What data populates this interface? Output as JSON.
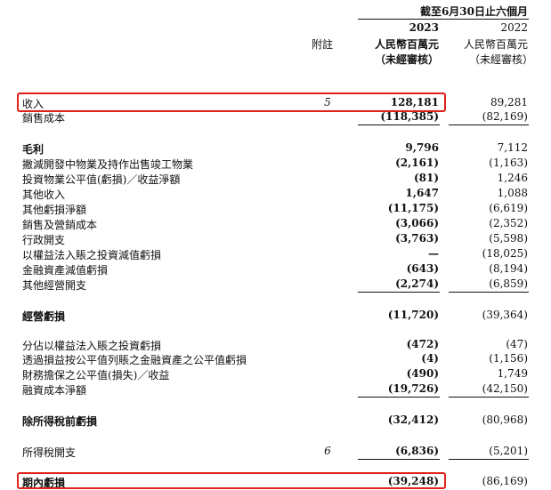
{
  "header": {
    "period": "截至6月30日止六個月",
    "note_label": "附註",
    "col2023": {
      "year": "2023",
      "unit": "人民幣百萬元",
      "audit": "（未經審核）"
    },
    "col2022": {
      "year": "2022",
      "unit": "人民幣百萬元",
      "audit": "（未經審核）"
    }
  },
  "rows": [
    {
      "label": "收入",
      "note": "5",
      "v2023": "128,181",
      "v2022": "89,281"
    },
    {
      "label": "銷售成本",
      "note": "",
      "v2023": "(118,385)",
      "v2022": "(82,169)"
    },
    {
      "label": "毛利",
      "note": "",
      "v2023": "9,796",
      "v2022": "7,112"
    },
    {
      "label": "撇減開發中物業及持作出售竣工物業",
      "note": "",
      "v2023": "(2,161)",
      "v2022": "(1,163)"
    },
    {
      "label": "投資物業公平值(虧損)／收益淨額",
      "note": "",
      "v2023": "(81)",
      "v2022": "1,246"
    },
    {
      "label": "其他收入",
      "note": "",
      "v2023": "1,647",
      "v2022": "1,088"
    },
    {
      "label": "其他虧損淨額",
      "note": "",
      "v2023": "(11,175)",
      "v2022": "(6,619)"
    },
    {
      "label": "銷售及營銷成本",
      "note": "",
      "v2023": "(3,066)",
      "v2022": "(2,352)"
    },
    {
      "label": "行政開支",
      "note": "",
      "v2023": "(3,763)",
      "v2022": "(5,598)"
    },
    {
      "label": "以權益法入賬之投資減值虧損",
      "note": "",
      "v2023": "—",
      "v2022": "(18,025)"
    },
    {
      "label": "金融資產減值虧損",
      "note": "",
      "v2023": "(643)",
      "v2022": "(8,194)"
    },
    {
      "label": "其他經營開支",
      "note": "",
      "v2023": "(2,274)",
      "v2022": "(6,859)"
    },
    {
      "label": "經營虧損",
      "note": "",
      "v2023": "(11,720)",
      "v2022": "(39,364)"
    },
    {
      "label": "分佔以權益法入賬之投資虧損",
      "note": "",
      "v2023": "(472)",
      "v2022": "(47)"
    },
    {
      "label": "透過損益按公平值列賬之金融資產之公平值虧損",
      "note": "",
      "v2023": "(4)",
      "v2022": "(1,156)"
    },
    {
      "label": "財務擔保之公平值(損失)／收益",
      "note": "",
      "v2023": "(490)",
      "v2022": "1,749"
    },
    {
      "label": "融資成本淨額",
      "note": "",
      "v2023": "(19,726)",
      "v2022": "(42,150)"
    },
    {
      "label": "除所得稅前虧損",
      "note": "",
      "v2023": "(32,412)",
      "v2022": "(80,968)"
    },
    {
      "label": "所得稅開支",
      "note": "6",
      "v2023": "(6,836)",
      "v2022": "(5,201)"
    },
    {
      "label": "期內虧損",
      "note": "",
      "v2023": "(39,248)",
      "v2022": "(86,169)"
    }
  ]
}
